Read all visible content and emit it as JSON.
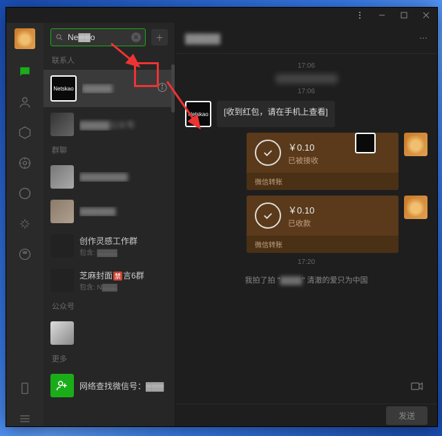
{
  "window": {
    "chat_title": "▓▓▓▓▓"
  },
  "search": {
    "value": "Ne▓▓o"
  },
  "sections": {
    "contacts": "联系人",
    "groups": "群聊",
    "official": "公众号",
    "more": "更多"
  },
  "list": {
    "c1": {
      "title": "▓▓▓▓▓",
      "thumb_label": "Netskao"
    },
    "c2": {
      "title": "▓▓▓▓▓公众号·"
    },
    "g1": {
      "title": "▓▓▓▓▓▓▓▓"
    },
    "g2": {
      "title": "▓▓▓▓▓▓"
    },
    "g3": {
      "title": "创作灵感工作群",
      "sub": "包含: ▓▓▓▓"
    },
    "g4": {
      "title_a": "芝麻封面",
      "title_b": "言6群",
      "sub": "包含: N▓▓▓"
    },
    "addf": {
      "title": "网络查找微信号：▓▓▓"
    }
  },
  "badge": {
    "restricted": "禁"
  },
  "chat": {
    "t1": "17:06",
    "t2": "17:06",
    "t3": "17:20",
    "msg1": "[收到红包，请在手机上查看]",
    "transfer1": {
      "amount": "￥0.10",
      "status": "已被接收",
      "foot": "微信转账"
    },
    "transfer2": {
      "amount": "￥0.10",
      "status": "已收款",
      "foot": "微信转账"
    },
    "pat_a": "我拍了拍 \"",
    "pat_b": "▓▓▓▓",
    "pat_c": "\" 清澈的爱只为中国",
    "send": "发送",
    "av_label": "Netskao"
  }
}
